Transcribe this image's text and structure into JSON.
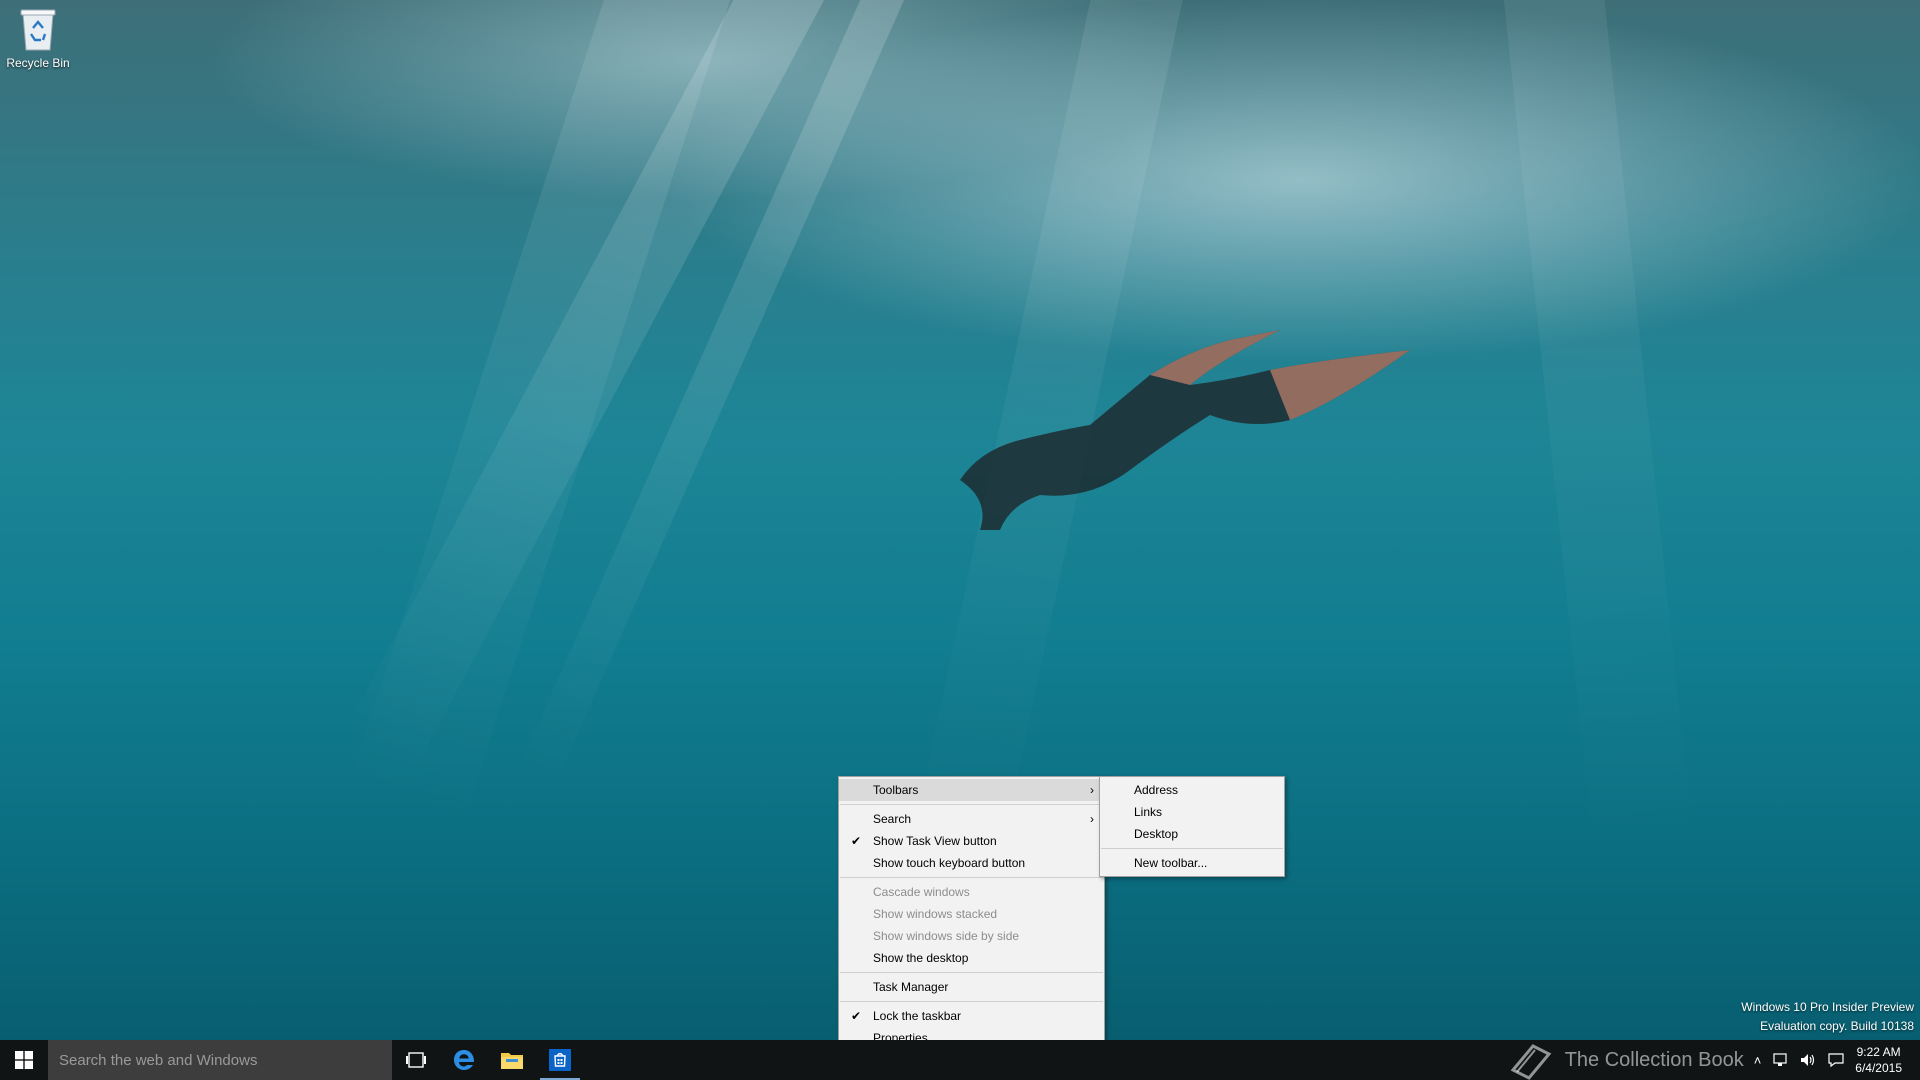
{
  "desktop": {
    "icons": [
      {
        "label": "Recycle Bin",
        "icon": "recycle-bin-icon"
      }
    ],
    "watermark": {
      "line1": "Windows 10 Pro Insider Preview",
      "line2": "Evaluation copy. Build 10138"
    },
    "brand_watermark": "The Collection Book"
  },
  "taskbar": {
    "search_placeholder": "Search the web and Windows",
    "apps": [
      {
        "name": "Task View",
        "icon": "task-view-icon"
      },
      {
        "name": "Microsoft Edge",
        "icon": "edge-icon"
      },
      {
        "name": "File Explorer",
        "icon": "folder-icon"
      },
      {
        "name": "Store",
        "icon": "store-icon"
      }
    ],
    "tray": {
      "time": "9:22 AM",
      "date": "6/4/2015"
    }
  },
  "context_menu": {
    "items": [
      {
        "label": "Toolbars",
        "submenu": true,
        "highlighted": true
      },
      {
        "label": "Search",
        "submenu": true
      },
      {
        "label": "Show Task View button",
        "checked": true
      },
      {
        "label": "Show touch keyboard button"
      },
      {
        "label": "Cascade windows",
        "disabled": true
      },
      {
        "label": "Show windows stacked",
        "disabled": true
      },
      {
        "label": "Show windows side by side",
        "disabled": true
      },
      {
        "label": "Show the desktop"
      },
      {
        "label": "Task Manager"
      },
      {
        "label": "Lock the taskbar",
        "checked": true
      },
      {
        "label": "Properties"
      }
    ],
    "toolbars_submenu": [
      {
        "label": "Address"
      },
      {
        "label": "Links"
      },
      {
        "label": "Desktop"
      },
      {
        "label": "New toolbar..."
      }
    ]
  },
  "colors": {
    "taskbar": "#101415",
    "search_box": "#3d3d3d",
    "menu_bg": "#f2f2f2",
    "menu_highlight": "#dadada",
    "accent": "#7aa9d6"
  }
}
